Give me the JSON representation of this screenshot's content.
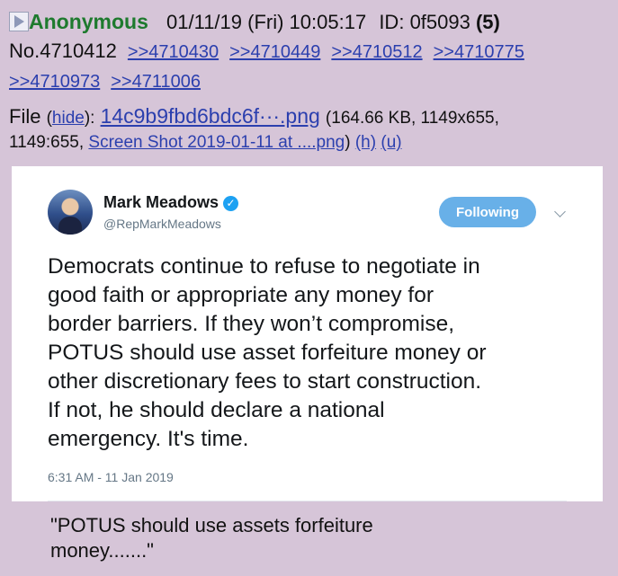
{
  "post": {
    "name": "Anonymous",
    "date": "01/11/19 (Fri) 10:05:17",
    "id_label": "ID:",
    "id": "0f5093",
    "id_count": "(5)",
    "number": "No.4710412",
    "replies": [
      ">>4710430",
      ">>4710449",
      ">>4710512",
      ">>4710775",
      ">>4710973",
      ">>4711006"
    ],
    "file": {
      "label": "File",
      "hide": "hide",
      "name": "14c9b9fbd6bdc6f···.png",
      "details": "(164.66 KB, 1149x655,",
      "details2": "1149:655,",
      "original_name": "Screen Shot 2019-01-11 at ....png",
      "h": "(h)",
      "u": "(u)"
    }
  },
  "tweet": {
    "author": "Mark Meadows",
    "handle": "@RepMarkMeadows",
    "follow_label": "Following",
    "lines": [
      "Democrats continue to refuse to negotiate in",
      "good faith or appropriate any money for",
      "border barriers. If they won’t compromise,",
      "POTUS should use asset forfeiture money or",
      "other discretionary fees to start construction.",
      "If not, he should declare a national",
      "emergency. It's time."
    ],
    "timestamp": "6:31 AM - 11 Jan 2019"
  },
  "comment": {
    "lines": [
      "\"POTUS should use assets forfeiture",
      "money.......\""
    ]
  },
  "colors": {
    "background": "#d6c5d8",
    "name": "#1e7a2e",
    "link": "#2b3fae",
    "follow_button": "#68b0e8"
  }
}
